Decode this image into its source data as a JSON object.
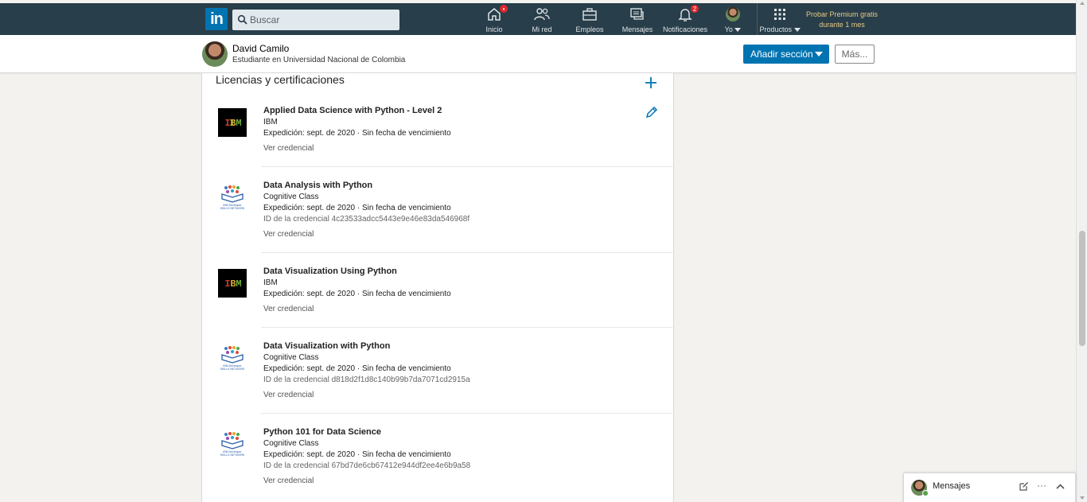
{
  "nav": {
    "search_placeholder": "Buscar",
    "items": [
      {
        "label": "Inicio",
        "icon": "home-icon",
        "badge": "•"
      },
      {
        "label": "Mi red",
        "icon": "network-icon",
        "badge": ""
      },
      {
        "label": "Empleos",
        "icon": "briefcase-icon",
        "badge": ""
      },
      {
        "label": "Mensajes",
        "icon": "messages-icon",
        "badge": ""
      },
      {
        "label": "Notificaciones",
        "icon": "bell-icon",
        "badge": "2"
      },
      {
        "label": "Yo",
        "icon": "avatar",
        "badge": ""
      },
      {
        "label": "Productos",
        "icon": "grid-icon",
        "badge": ""
      }
    ],
    "premium": "Probar Premium gratis durante 1 mes",
    "brand_color": "#0073b1",
    "bar_color": "#283e4a"
  },
  "profile": {
    "name": "David Camilo",
    "headline": "Estudiante en Universidad Nacional de Colombia",
    "add_section_label": "Añadir sección",
    "more_label": "Más..."
  },
  "section": {
    "title": "Licencias y certificaciones",
    "entries": [
      {
        "title": "Applied Data Science with Python - Level 2",
        "issuer": "IBM",
        "dates": "Expedición: sept. de 2020 · Sin fecha de vencimiento",
        "credential_id": "",
        "link": "Ver credencial",
        "logo": "ibm-logo"
      },
      {
        "title": "Data Analysis with Python",
        "issuer": "Cognitive Class",
        "dates": "Expedición: sept. de 2020 · Sin fecha de vencimiento",
        "credential_id": "ID de la credencial 4c23533adcc5443e9e46e83da546968f",
        "link": "Ver credencial",
        "logo": "cognitive-class-logo"
      },
      {
        "title": "Data Visualization Using Python",
        "issuer": "IBM",
        "dates": "Expedición: sept. de 2020 · Sin fecha de vencimiento",
        "credential_id": "",
        "link": "Ver credencial",
        "logo": "ibm-logo"
      },
      {
        "title": "Data Visualization with Python",
        "issuer": "Cognitive Class",
        "dates": "Expedición: sept. de 2020 · Sin fecha de vencimiento",
        "credential_id": "ID de la credencial d818d2f1d8c140b99b7da7071cd2915a",
        "link": "Ver credencial",
        "logo": "cognitive-class-logo"
      },
      {
        "title": "Python 101 for Data Science",
        "issuer": "Cognitive Class",
        "dates": "Expedición: sept. de 2020 · Sin fecha de vencimiento",
        "credential_id": "ID de la credencial 67bd7de6cb67412e944df2ee4e6b9a58",
        "link": "Ver credencial",
        "logo": "cognitive-class-logo"
      }
    ]
  },
  "messaging": {
    "label": "Mensajes"
  }
}
